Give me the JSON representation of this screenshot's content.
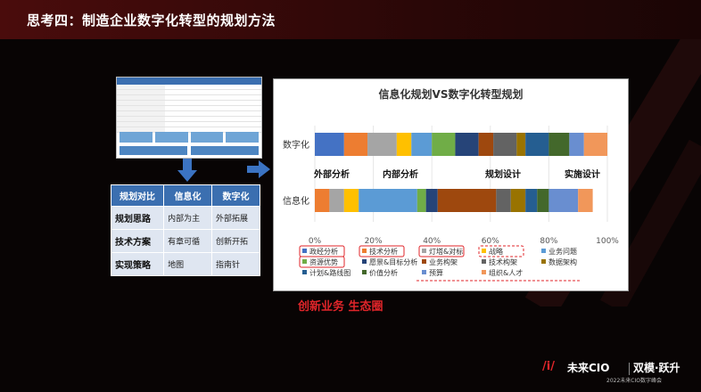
{
  "slide": {
    "title": "思考四：制造企业数字化转型的规划方法"
  },
  "comparison_table": {
    "headers": [
      "规划对比",
      "信息化",
      "数字化"
    ],
    "rows": [
      [
        "规划思路",
        "内部为主",
        "外部拓展"
      ],
      [
        "技术方案",
        "有章可循",
        "创新开拓"
      ],
      [
        "实现策略",
        "地图",
        "指南针"
      ]
    ]
  },
  "chart_data": {
    "type": "bar",
    "orientation": "horizontal",
    "stacked": true,
    "title": "信息化规划VS数字化转型规划",
    "categories": [
      "数字化",
      "信息化"
    ],
    "xlim": [
      0,
      100
    ],
    "x_ticks": [
      "0%",
      "20%",
      "40%",
      "60%",
      "80%",
      "100%"
    ],
    "annotations": [
      "外部分析",
      "内部分析",
      "规划设计",
      "实施设计"
    ],
    "legend_position": "bottom",
    "series": [
      {
        "name": "政经分析",
        "color": "#4472c4",
        "values": [
          10,
          0
        ]
      },
      {
        "name": "技术分析",
        "color": "#ed7d31",
        "values": [
          8,
          5
        ]
      },
      {
        "name": "灯塔&对标",
        "color": "#a5a5a5",
        "values": [
          10,
          5
        ]
      },
      {
        "name": "战略",
        "color": "#ffc000",
        "values": [
          5,
          5
        ]
      },
      {
        "name": "业务问题",
        "color": "#5b9bd5",
        "values": [
          7,
          20
        ]
      },
      {
        "name": "资源优势",
        "color": "#70ad47",
        "values": [
          8,
          3
        ]
      },
      {
        "name": "愿景&目标分析",
        "color": "#264478",
        "values": [
          8,
          4
        ]
      },
      {
        "name": "业务构架",
        "color": "#9e480e",
        "values": [
          5,
          20
        ]
      },
      {
        "name": "技术构架",
        "color": "#636363",
        "values": [
          8,
          5
        ]
      },
      {
        "name": "数据架构",
        "color": "#997300",
        "values": [
          3,
          5
        ]
      },
      {
        "name": "计划&路线图",
        "color": "#255e91",
        "values": [
          8,
          4
        ]
      },
      {
        "name": "价值分析",
        "color": "#43682b",
        "values": [
          7,
          4
        ]
      },
      {
        "name": "预算",
        "color": "#698ed0",
        "values": [
          5,
          10
        ]
      },
      {
        "name": "组织&人才",
        "color": "#f1975a",
        "values": [
          8,
          5
        ]
      }
    ]
  },
  "tagline": "创新业务   生态圈",
  "brand": {
    "logo_text": "未来CIO",
    "event_text": "双模·跃升",
    "sub_text": "2022未来CIO数字峰会"
  }
}
